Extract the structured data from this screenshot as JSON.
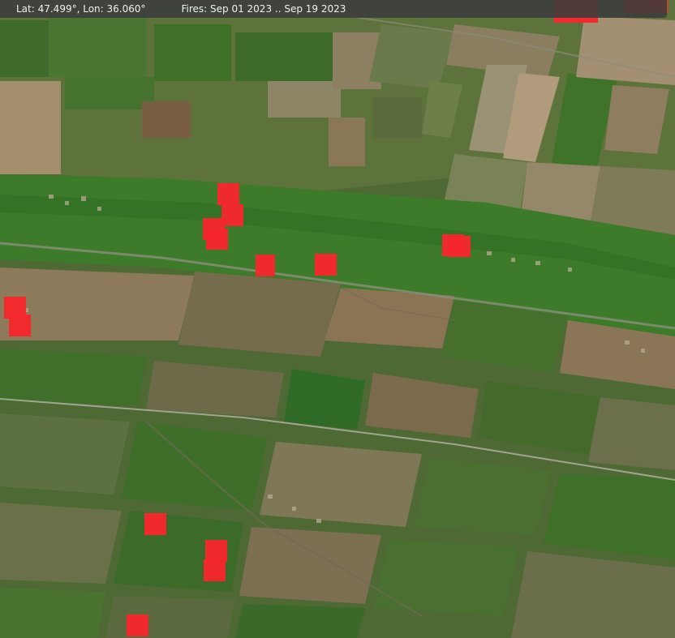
{
  "info_bar": {
    "coords": "Lat: 47.499°, Lon: 36.060°",
    "fire_range": "Fires: Sep 01 2023 .. Sep 19 2023"
  },
  "colors": {
    "fire_marker": "#f5272c",
    "info_bar_bg": "#3c3c3c"
  },
  "map": {
    "type": "satellite imagery",
    "features": [
      "field-parcels",
      "river-valley",
      "villages",
      "roads"
    ],
    "fire_marker_count": 17
  }
}
